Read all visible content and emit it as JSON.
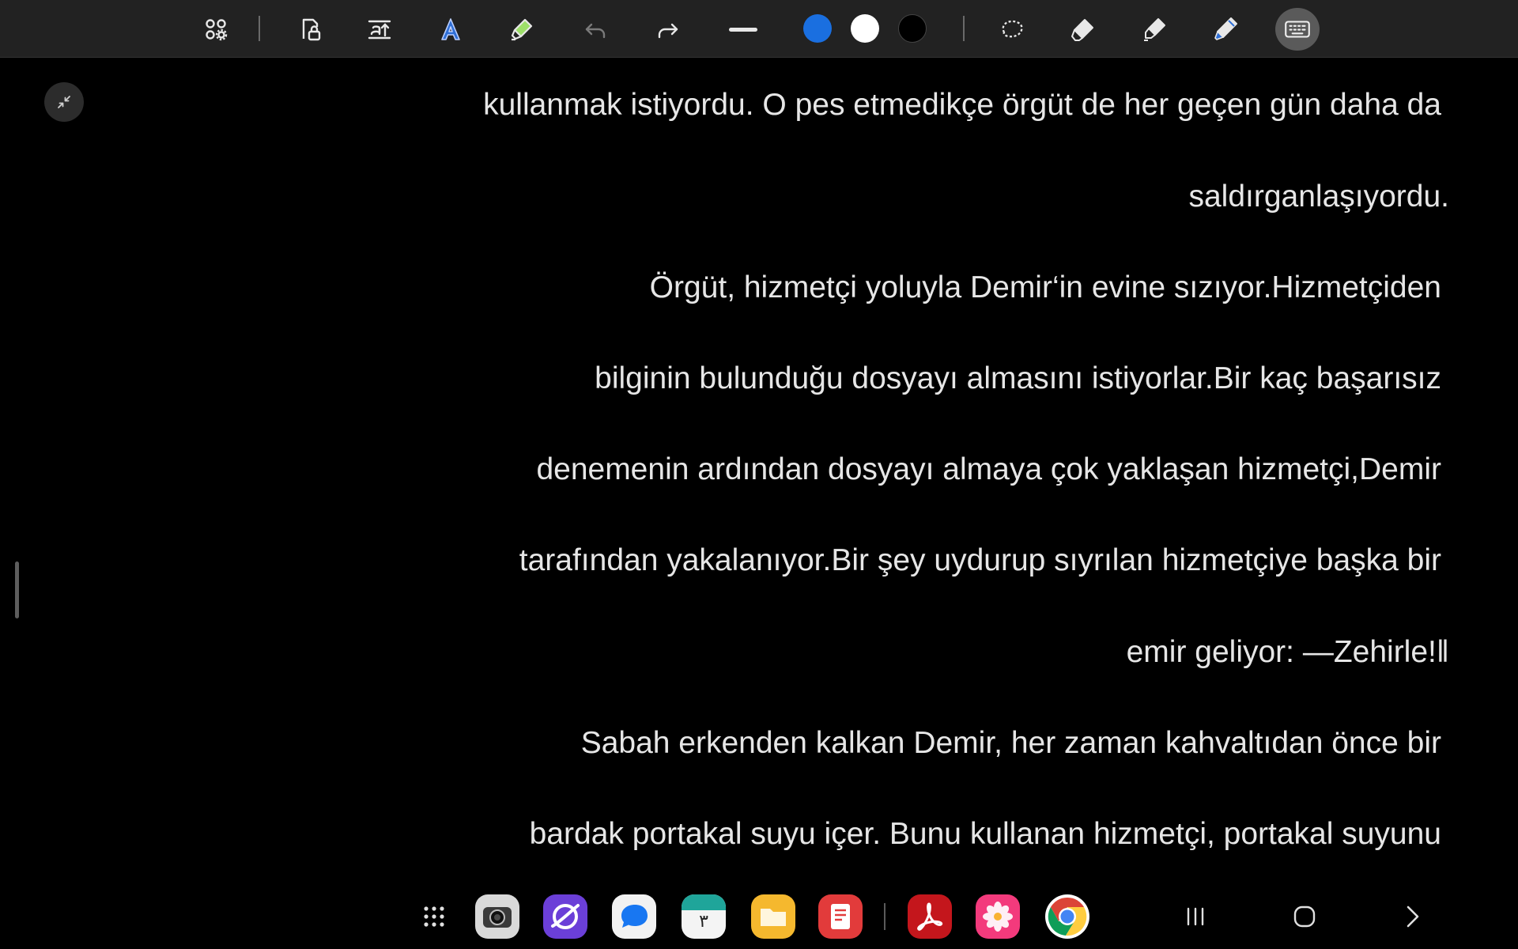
{
  "toolbar": {
    "tools": [
      {
        "icon": "apps-settings-icon"
      },
      {
        "icon": "lock-document-icon"
      },
      {
        "icon": "text-size-icon"
      },
      {
        "icon": "text-style-icon"
      },
      {
        "icon": "highlighter-icon"
      },
      {
        "icon": "undo-icon"
      },
      {
        "icon": "redo-icon"
      },
      {
        "icon": "stroke-width-icon"
      }
    ],
    "colors": [
      "#1a6fe0",
      "#ffffff",
      "#000000"
    ],
    "right_tools": [
      {
        "icon": "lasso-select-icon"
      },
      {
        "icon": "eraser-icon"
      },
      {
        "icon": "marker-icon"
      },
      {
        "icon": "pen-icon"
      },
      {
        "icon": "keyboard-icon"
      }
    ]
  },
  "reader": {
    "lines": [
      "kullanmak istiyordu. O pes etmedikçe örgüt de her geçen gün daha da",
      "saldırganlaşıyordu.",
      "Örgüt, hizmetçi yoluyla Demir‘in evine sızıyor.Hizmetçiden",
      "bilginin bulunduğu dosyayı almasını istiyorlar.Bir kaç başarısız",
      "denemenin ardından dosyayı almaya çok yaklaşan hizmetçi,Demir",
      "tarafından yakalanıyor.Bir şey uydurup sıyrılan hizmetçiye başka bir",
      "emir geliyor: ―Zehirle!‖",
      "Sabah erkenden kalkan Demir, her zaman kahvaltıdan önce bir",
      "bardak portakal suyu içer. Bunu kullanan hizmetçi, portakal suyunu"
    ]
  },
  "taskbar": {
    "apps": [
      {
        "name": "app-drawer-icon"
      },
      {
        "name": "camera-app-icon"
      },
      {
        "name": "internet-app-icon"
      },
      {
        "name": "messages-app-icon"
      },
      {
        "name": "calendar-app-icon",
        "label": "۳"
      },
      {
        "name": "files-app-icon"
      },
      {
        "name": "notes-app-icon"
      },
      {
        "name": "acrobat-app-icon"
      },
      {
        "name": "gallery-app-icon"
      },
      {
        "name": "chrome-app-icon"
      }
    ],
    "nav": [
      "recents-icon",
      "home-icon",
      "back-forward-icon"
    ]
  }
}
